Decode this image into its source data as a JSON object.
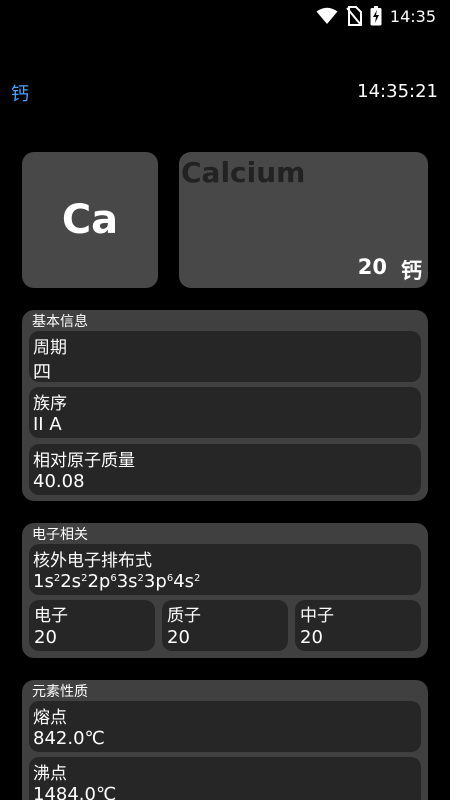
{
  "status_bar": {
    "time": "14:35",
    "icons": [
      "wifi-icon",
      "no-sim-icon",
      "battery-charging-icon"
    ]
  },
  "app_bar": {
    "title": "钙",
    "clock": "14:35:21",
    "accent_color": "#4aa3ff"
  },
  "element": {
    "symbol": "Ca",
    "english_name": "Calcium",
    "atomic_number": "20",
    "chinese_name": "钙"
  },
  "basic_info": {
    "title": "基本信息",
    "period_label": "周期",
    "period_value": "四",
    "group_label": "族序",
    "group_value": "II A",
    "mass_label": "相对原子质量",
    "mass_value": "40.08"
  },
  "electron_info": {
    "title": "电子相关",
    "config_label": "核外电子排布式",
    "config_parts": [
      {
        "base": "1s",
        "sup": "2"
      },
      {
        "base": "2s",
        "sup": "2"
      },
      {
        "base": "2p",
        "sup": "6"
      },
      {
        "base": "3s",
        "sup": "2"
      },
      {
        "base": "3p",
        "sup": "6"
      },
      {
        "base": "4s",
        "sup": "2"
      }
    ],
    "electron_label": "电子",
    "electron_value": "20",
    "proton_label": "质子",
    "proton_value": "20",
    "neutron_label": "中子",
    "neutron_value": "20"
  },
  "properties": {
    "title": "元素性质",
    "melting_label": "熔点",
    "melting_value": "842.0℃",
    "boiling_label": "沸点",
    "boiling_value": "1484.0℃"
  }
}
